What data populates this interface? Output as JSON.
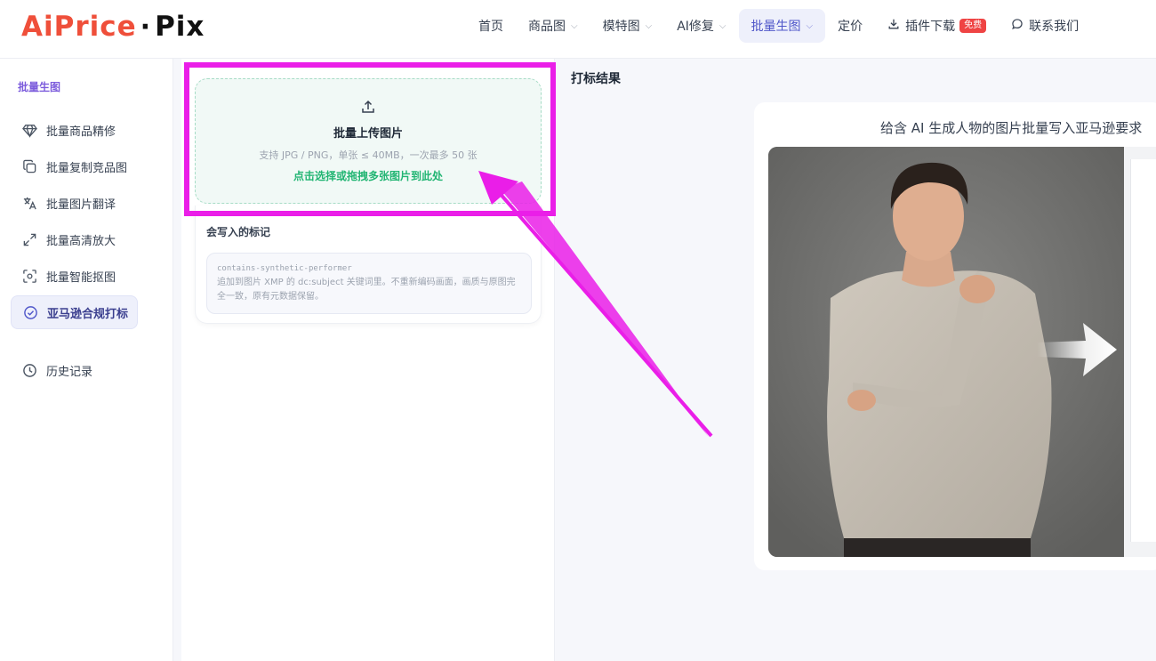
{
  "logo": {
    "part1": "AiPrice",
    "dot": "·",
    "part2": "Pix"
  },
  "nav": {
    "home": "首页",
    "product": "商品图",
    "model": "模特图",
    "ai_repair": "AI修复",
    "batch": "批量生图",
    "pricing": "定价",
    "plugin": "插件下载",
    "plugin_badge": "免费",
    "contact": "联系我们"
  },
  "sidebar": {
    "section": "批量生图",
    "items": [
      {
        "label": "批量商品精修",
        "icon": "diamond-icon"
      },
      {
        "label": "批量复制竞品图",
        "icon": "copy-icon"
      },
      {
        "label": "批量图片翻译",
        "icon": "translate-icon"
      },
      {
        "label": "批量高清放大",
        "icon": "expand-icon"
      },
      {
        "label": "批量智能抠图",
        "icon": "focus-icon"
      },
      {
        "label": "亚马逊合规打标",
        "icon": "check-circle-icon"
      }
    ],
    "history": {
      "label": "历史记录",
      "icon": "clock-icon"
    }
  },
  "upload": {
    "title": "批量上传图片",
    "subtitle": "支持 JPG / PNG，单张 ≤ 40MB，一次最多 50 张",
    "link": "点击选择或拖拽多张图片到此处"
  },
  "marks": {
    "title": "会写入的标记",
    "code": "contains-synthetic-performer",
    "description": "追加到图片 XMP 的 dc:subject 关键词里。不重新编码画面，画质与原图完全一致，原有元数据保留。"
  },
  "result": {
    "title": "打标结果",
    "caption": "给含 AI 生成人物的图片批量写入亚马逊要求"
  },
  "colors": {
    "accent": "#4f56c9",
    "green": "#22b573",
    "highlight": "#ea1ee8",
    "logo_red": "#ef4f3a"
  }
}
